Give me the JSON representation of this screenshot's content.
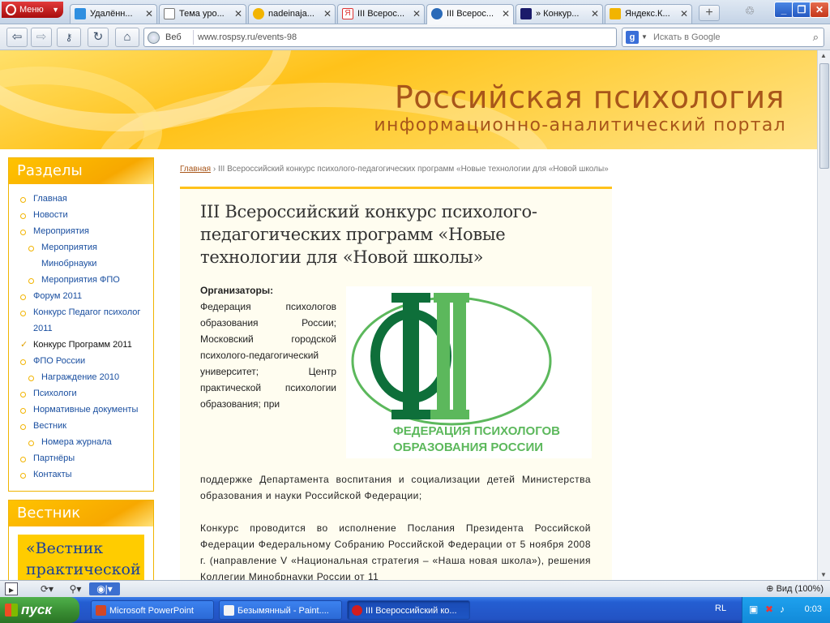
{
  "browser": {
    "menu_label": "Меню",
    "tabs": [
      {
        "label": "Удалённ...",
        "active": false
      },
      {
        "label": "Тема уро...",
        "active": false
      },
      {
        "label": "nadeinaja...",
        "active": false
      },
      {
        "label": "III Всерос...",
        "active": false
      },
      {
        "label": "III Всерос...",
        "active": true
      },
      {
        "label": "» Конкур...",
        "active": false
      },
      {
        "label": "Яндекс.К...",
        "active": false
      }
    ],
    "address_prefix": "Веб",
    "url": "www.rospsy.ru/events-98",
    "search_engine": "Google",
    "search_placeholder": "Искать в Google",
    "zoom_label": "Вид (100%)"
  },
  "site": {
    "title": "Российская психология",
    "subtitle": "информационно-аналитический портал"
  },
  "sidebar": {
    "sections_title": "Разделы",
    "nav": [
      {
        "label": "Главная",
        "level": 0,
        "current": false
      },
      {
        "label": "Новости",
        "level": 0,
        "current": false
      },
      {
        "label": "Мероприятия",
        "level": 0,
        "current": false
      },
      {
        "label": "Мероприятия Минобрнауки",
        "level": 1,
        "current": false
      },
      {
        "label": "Мероприятия ФПО",
        "level": 1,
        "current": false
      },
      {
        "label": "Форум 2011",
        "level": 0,
        "current": false
      },
      {
        "label": "Конкурс Педагог психолог 2011",
        "level": 0,
        "current": false
      },
      {
        "label": "Конкурс Программ 2011",
        "level": 0,
        "current": true
      },
      {
        "label": "ФПО России",
        "level": 0,
        "current": false
      },
      {
        "label": "Награждение 2010",
        "level": 1,
        "current": false
      },
      {
        "label": "Психологи",
        "level": 0,
        "current": false
      },
      {
        "label": "Нормативные документы",
        "level": 0,
        "current": false
      },
      {
        "label": "Вестник",
        "level": 0,
        "current": false
      },
      {
        "label": "Номера журнала",
        "level": 1,
        "current": false
      },
      {
        "label": "Партнёры",
        "level": 0,
        "current": false
      },
      {
        "label": "Контакты",
        "level": 0,
        "current": false
      }
    ],
    "vestnik_title": "Вестник",
    "vestnik_banner": "«Вестник практической"
  },
  "breadcrumb": {
    "home": "Главная",
    "separator": "›",
    "current": "III Всероссийский конкурс психолого-педагогических программ «Новые технологии для «Новой школы»"
  },
  "article": {
    "title": "III Всероссийский конкурс психолого-педагогических программ «Новые технологии для «Новой школы»",
    "organizers_heading": "Организаторы:",
    "organizers_text": "Федерация психологов образования России; Московский городской психолого-педагогический университет; Центр практической психологии образования; при",
    "continuation": "поддержке Департамента воспитания и социализации детей Министерства образования и науки Российской Федерации;",
    "paragraph2": "Конкурс проводится во исполнение Послания Президента Российской Федерации Федеральному Собранию Российской Федерации от 5 ноября 2008 г. (направление V «Национальная стратегия – «Наша новая школа»), решения Коллегии Минобрнауки России от 11",
    "logo_line1": "ФЕДЕРАЦИЯ ПСИХОЛОГОВ",
    "logo_line2": "ОБРАЗОВАНИЯ РОССИИ",
    "logo_color_dark": "#0e6f3a",
    "logo_color_light": "#5cb85c"
  },
  "taskbar": {
    "start_label": "пуск",
    "tasks": [
      {
        "label": "Microsoft PowerPoint",
        "active": false
      },
      {
        "label": "Безымянный - Paint....",
        "active": false
      },
      {
        "label": "III Всероссийский ко...",
        "active": true
      }
    ],
    "lang": "RL",
    "clock": "0:03"
  },
  "colors": {
    "accent": "#ffc21a",
    "title_brown": "#a8561a",
    "link_blue": "#1a4fa0"
  }
}
